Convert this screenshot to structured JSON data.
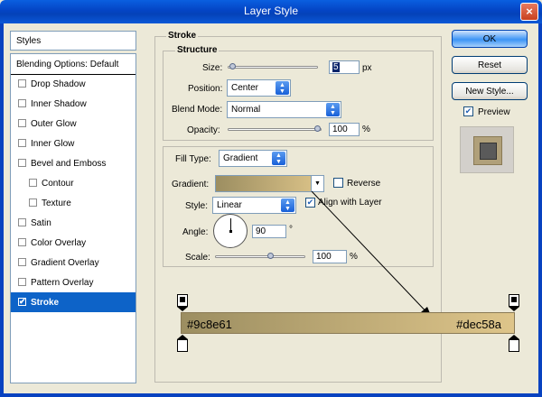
{
  "window": {
    "title": "Layer Style",
    "close": "×"
  },
  "styles": {
    "header": "Styles",
    "items": [
      {
        "label": "Blending Options: Default",
        "check": false,
        "header": true
      },
      {
        "label": "Drop Shadow",
        "check": false
      },
      {
        "label": "Inner Shadow",
        "check": false
      },
      {
        "label": "Outer Glow",
        "check": false
      },
      {
        "label": "Inner Glow",
        "check": false
      },
      {
        "label": "Bevel and Emboss",
        "check": false
      },
      {
        "label": "Contour",
        "check": false,
        "indent": true
      },
      {
        "label": "Texture",
        "check": false,
        "indent": true
      },
      {
        "label": "Satin",
        "check": false
      },
      {
        "label": "Color Overlay",
        "check": false
      },
      {
        "label": "Gradient Overlay",
        "check": false
      },
      {
        "label": "Pattern Overlay",
        "check": false
      },
      {
        "label": "Stroke",
        "check": true,
        "selected": true
      }
    ]
  },
  "stroke": {
    "title": "Stroke",
    "structure": {
      "title": "Structure",
      "size_label": "Size:",
      "size_value": "5",
      "size_unit": "px",
      "position_label": "Position:",
      "position_value": "Center",
      "blend_label": "Blend Mode:",
      "blend_value": "Normal",
      "opacity_label": "Opacity:",
      "opacity_value": "100",
      "opacity_unit": "%"
    },
    "fill": {
      "type_label": "Fill Type:",
      "type_value": "Gradient",
      "gradient_label": "Gradient:",
      "reverse_label": "Reverse",
      "reverse_checked": false,
      "style_label": "Style:",
      "style_value": "Linear",
      "align_label": "Align with Layer",
      "align_checked": true,
      "angle_label": "Angle:",
      "angle_value": "90",
      "angle_unit": "°",
      "scale_label": "Scale:",
      "scale_value": "100",
      "scale_unit": "%"
    }
  },
  "buttons": {
    "ok": "OK",
    "reset": "Reset",
    "new_style": "New Style...",
    "preview": "Preview",
    "preview_checked": true
  },
  "gradient_editor": {
    "start_color": "#9c8e61",
    "end_color": "#dec58a",
    "start_label": "#9c8e61",
    "end_label": "#dec58a"
  }
}
